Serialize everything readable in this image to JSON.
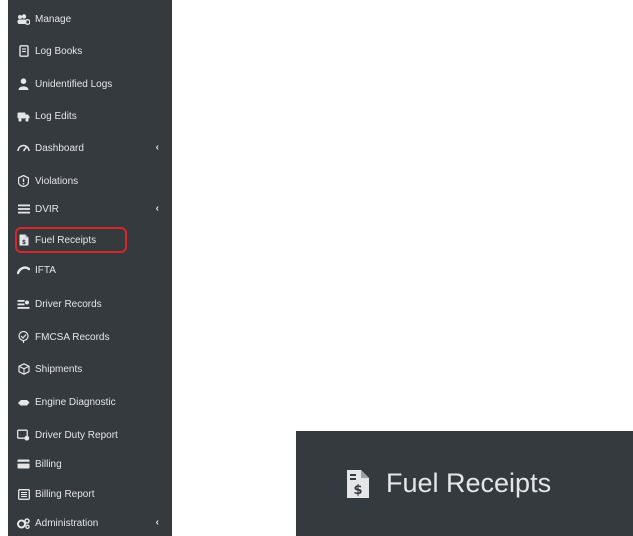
{
  "sidebar": {
    "items": [
      {
        "label": "Manage",
        "icon": "users-cog-icon"
      },
      {
        "label": "Log Books",
        "icon": "book-icon"
      },
      {
        "label": "Unidentified Logs",
        "icon": "user-icon"
      },
      {
        "label": "Log Edits",
        "icon": "truck-edit-icon"
      },
      {
        "label": "Dashboard",
        "icon": "gauge-icon",
        "has_submenu": true
      },
      {
        "label": "Violations",
        "icon": "alert-icon"
      },
      {
        "label": "DVIR",
        "icon": "bars-icon",
        "has_submenu": true
      },
      {
        "label": "Fuel Receipts",
        "icon": "receipt-icon",
        "highlighted": true
      },
      {
        "label": "IFTA",
        "icon": "road-icon"
      },
      {
        "label": "Driver Records",
        "icon": "records-icon"
      },
      {
        "label": "FMCSA Records",
        "icon": "shield-icon"
      },
      {
        "label": "Shipments",
        "icon": "box-icon"
      },
      {
        "label": "Engine Diagnostic",
        "icon": "engine-icon"
      },
      {
        "label": "Driver Duty Report",
        "icon": "duty-report-icon"
      },
      {
        "label": "Billing",
        "icon": "credit-card-icon"
      },
      {
        "label": "Billing Report",
        "icon": "list-icon"
      },
      {
        "label": "Administration",
        "icon": "cogs-icon",
        "has_submenu": true
      }
    ],
    "submenu_glyph": "‹"
  },
  "zoom_callout": {
    "label": "Fuel Receipts",
    "icon": "receipt-icon"
  },
  "colors": {
    "sidebar_bg": "#353a3f",
    "text": "#e4e6e8",
    "highlight": "#d9242b"
  }
}
